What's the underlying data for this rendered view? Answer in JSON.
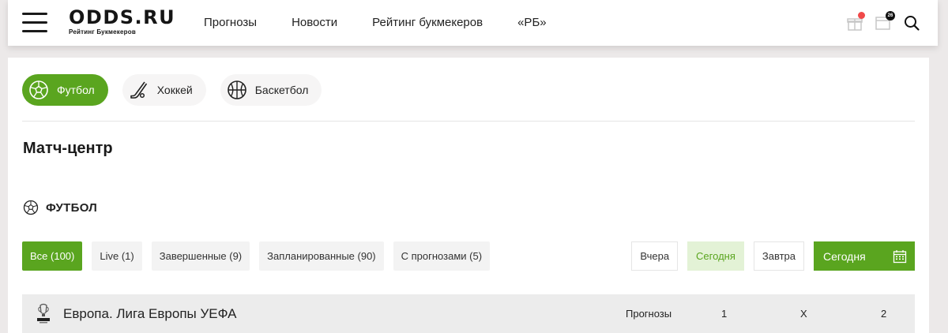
{
  "header": {
    "logo": "ODDS.RU",
    "logo_sub": "Рейтинг Букмекеров",
    "nav": [
      "Прогнозы",
      "Новости",
      "Рейтинг букмекеров",
      "«РБ»"
    ],
    "calendar_badge": "26",
    "icons": [
      "gift-icon",
      "calendar-icon",
      "search-icon"
    ],
    "notification_color": "#f04949"
  },
  "sports": [
    {
      "label": "Футбол",
      "icon": "soccer-ball-icon",
      "active": true
    },
    {
      "label": "Хоккей",
      "icon": "hockey-stick-icon",
      "active": false
    },
    {
      "label": "Баскетбол",
      "icon": "basketball-icon",
      "active": false
    }
  ],
  "page_title": "Матч-центр",
  "section_title": "ФУТБОЛ",
  "filters": [
    "Все (100)",
    "Live (1)",
    "Завершенные (9)",
    "Запланированные (90)",
    "С прогнозами (5)"
  ],
  "days": [
    "Вчера",
    "Сегодня",
    "Завтра"
  ],
  "date_picker": "Сегодня",
  "league": {
    "name": "Европа. Лига Европы УЕФА",
    "logo_text": "EUROPA LEAGUE",
    "columns": [
      "Прогнозы",
      "1",
      "X",
      "2"
    ]
  },
  "colors": {
    "accent": "#5aa51f",
    "accent_light": "#e3f2d6",
    "page_bg": "#ece9e9"
  }
}
